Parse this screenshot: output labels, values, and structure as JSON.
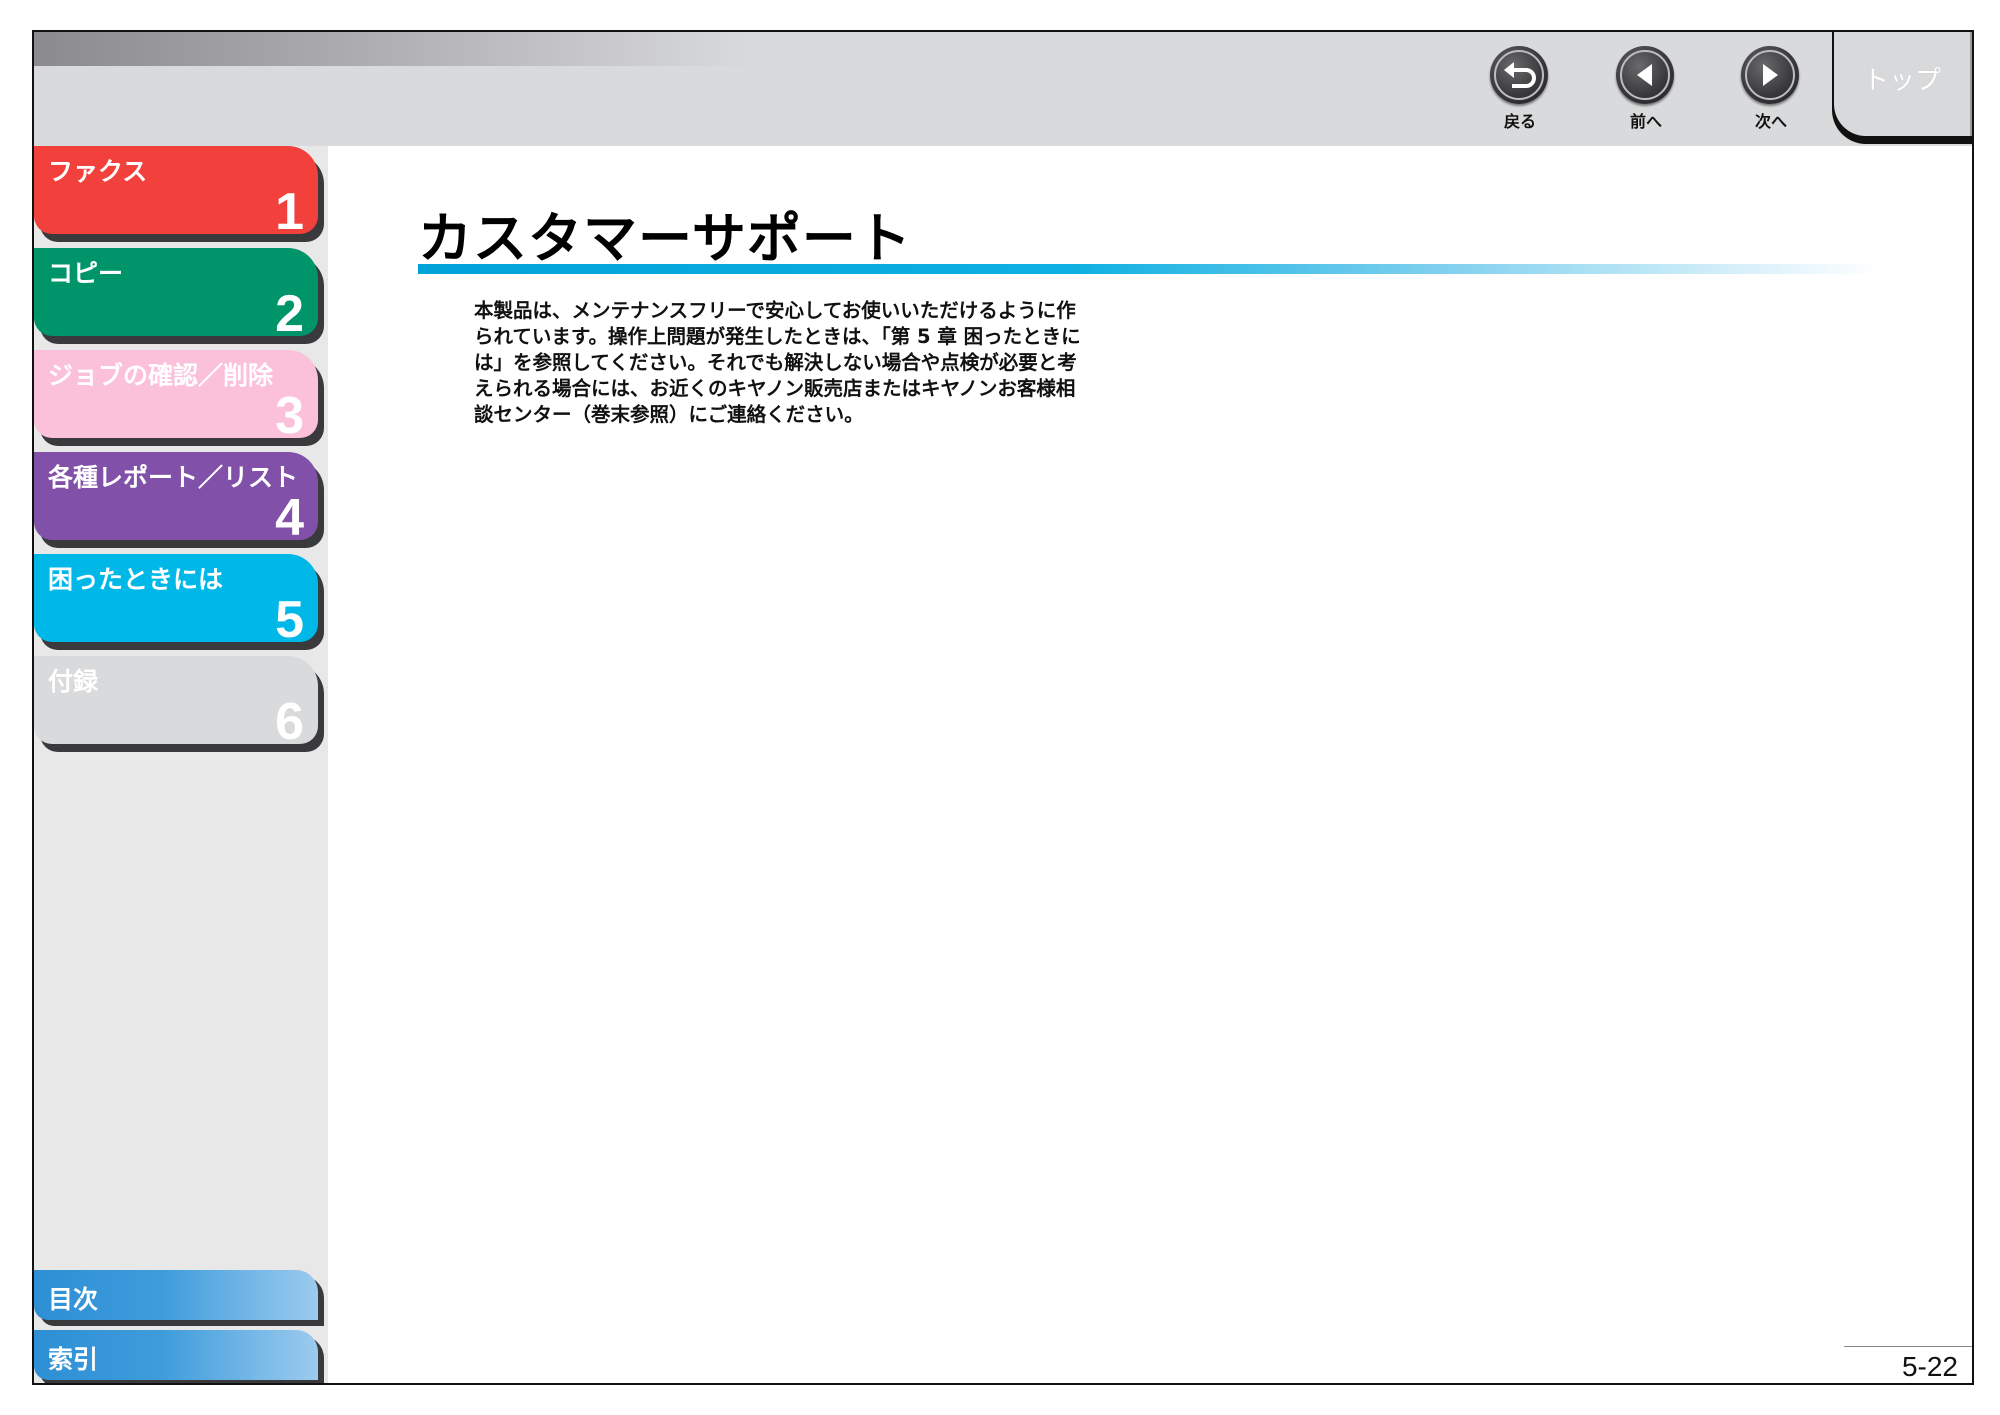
{
  "nav": {
    "back": {
      "label": "戻る",
      "icon": "return-arrow-icon"
    },
    "prev": {
      "label": "前へ",
      "icon": "triangle-left-icon"
    },
    "next": {
      "label": "次へ",
      "icon": "triangle-right-icon"
    },
    "top": {
      "label": "トップ"
    }
  },
  "chapters": [
    {
      "title": "ファクス",
      "number": "1",
      "color": "#f2403c"
    },
    {
      "title": "コピー",
      "number": "2",
      "color": "#00946a"
    },
    {
      "title": "ジョブの確認／削除",
      "number": "3",
      "color": "#fbc0da"
    },
    {
      "title": "各種レポート／リスト",
      "number": "4",
      "color": "#8150a8"
    },
    {
      "title": "困ったときには",
      "number": "5",
      "color": "#00b8e8"
    },
    {
      "title": "付録",
      "number": "6",
      "color": "#d9dadb"
    }
  ],
  "bottom_links": {
    "contents": "目次",
    "index": "索引"
  },
  "main": {
    "title": "カスタマーサポート",
    "body": "本製品は、メンテナンスフリーで安心してお使いいただけるように作\nられています。操作上問題が発生したときは、「第 5 章 困ったときに\nは」を参照してください。それでも解決しない場合や点検が必要と考\nえられる場合には、お近くのキヤノン販売店またはキヤノンお客様相\n談センター（巻末参照）にご連絡ください。",
    "page_number": "5-22"
  }
}
